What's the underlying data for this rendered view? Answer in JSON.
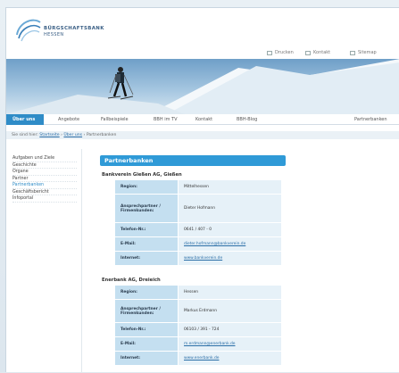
{
  "logo": {
    "line1": "BÜRGSCHAFTSBANK",
    "line2": "HESSEN"
  },
  "utility": {
    "print": "Drucken",
    "contact": "Kontakt",
    "sitemap": "Sitemap"
  },
  "nav": {
    "items": [
      "Über uns",
      "Angebote",
      "Fallbeispiele",
      "BBH im TV",
      "Kontakt",
      "BBH-Blog",
      "Partnerbanken"
    ]
  },
  "breadcrumb": {
    "prefix": "Sie sind hier:",
    "home": "Startseite",
    "section": "Über uns",
    "current": "Partnerbanken"
  },
  "sidebar": {
    "items": [
      {
        "label": "Aufgaben und Ziele"
      },
      {
        "label": "Geschichte"
      },
      {
        "label": "Organe"
      },
      {
        "label": "Partner"
      },
      {
        "label": "Partnerbanken"
      },
      {
        "label": "Geschäftsbericht"
      },
      {
        "label": "Infoportal"
      }
    ]
  },
  "main": {
    "heading": "Partnerbanken",
    "banks": [
      {
        "name": "Bankverein Gießen AG, Gießen",
        "rows": [
          {
            "key": "Region:",
            "value": "Mittelhessen"
          },
          {
            "key": "Ansprechpartner / Firmenkunden:",
            "value": "Dieter Hofmann"
          },
          {
            "key": "Telefon-Nr.:",
            "value": "0641 / 407 - 0"
          },
          {
            "key": "E-Mail:",
            "value": "dieter.hofmann@bankverein.de"
          },
          {
            "key": "Internet:",
            "value": "www.bankverein.de"
          }
        ]
      },
      {
        "name": "Enerbank AG, Dreieich",
        "rows": [
          {
            "key": "Region:",
            "value": "Hessen"
          },
          {
            "key": "Ansprechpartner / Firmenkunden:",
            "value": "Markus Erdmann"
          },
          {
            "key": "Telefon-Nr.:",
            "value": "06103 / 391 - 724"
          },
          {
            "key": "E-Mail:",
            "value": "m.erdmann@enerbank.de"
          },
          {
            "key": "Internet:",
            "value": "www.enerbank.de"
          }
        ]
      }
    ]
  }
}
